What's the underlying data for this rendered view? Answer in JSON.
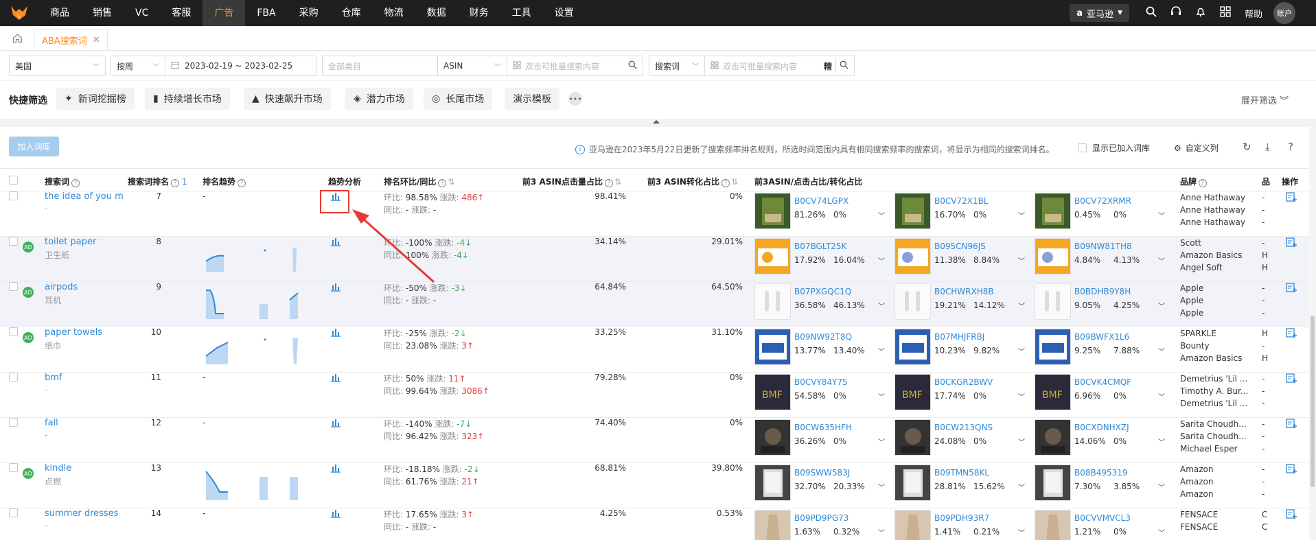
{
  "nav": {
    "items": [
      "商品",
      "销售",
      "VC",
      "客服",
      "广告",
      "FBA",
      "采购",
      "仓库",
      "物流",
      "数据",
      "财务",
      "工具",
      "设置"
    ],
    "active_index": 4,
    "market": "亚马逊",
    "help": "帮助",
    "account": "账户"
  },
  "tabs": {
    "page_tab": "ABA搜索词"
  },
  "filters": {
    "country": "美国",
    "period": "按周",
    "date_range": "2023-02-19 ~ 2023-02-25",
    "category_placeholder": "全部类目",
    "asin_type": "ASIN",
    "asin_placeholder": "双击可批量搜索内容",
    "term_type": "搜索词",
    "term_placeholder": "双击可批量搜索内容",
    "precise": "精"
  },
  "quick": {
    "label": "快捷筛选",
    "buttons": [
      "新词挖掘榜",
      "持续增长市场",
      "快速飙升市场",
      "潜力市场",
      "长尾市场",
      "演示模板"
    ],
    "expand": "展开筛选"
  },
  "toolbar": {
    "add_button": "加入词库",
    "notice": "亚马逊在2023年5月22日更新了搜索频率排名规则，所选时间范围内具有相同搜索频率的搜索词，将显示为相同的搜索词排名。",
    "show_added": "显示已加入词库",
    "custom_cols": "自定义列"
  },
  "columns": {
    "keyword": "搜索词",
    "rank": "搜索词排名",
    "rank_sort": "1",
    "rank_trend": "排名趋势",
    "trend": "趋势分析",
    "change": "排名环比/同比",
    "click_share": "前3 ASIN点击量占比",
    "conv_share": "前3 ASIN转化占比",
    "top3": "前3ASIN/点击占比/转化占比",
    "brand": "品牌",
    "brand2": "品",
    "ops": "操作"
  },
  "labels": {
    "hb": "环比:",
    "tb": "同比:",
    "zd": "涨跌:"
  },
  "rows": [
    {
      "keyword": "the idea of you m",
      "cn": "-",
      "ad": false,
      "rank": "7",
      "trend_text": "-",
      "hb": "98.58%",
      "hb_zd": "486",
      "hb_dir": "up",
      "tb": "-",
      "tb_zd": "-",
      "tb_dir": "",
      "click": "98.41%",
      "conv": "0%",
      "asins": [
        {
          "code": "B0CV74LGPX",
          "c": "81.26%",
          "v": "0%"
        },
        {
          "code": "B0CV72X1BL",
          "c": "16.70%",
          "v": "0%"
        },
        {
          "code": "B0CV72XRMR",
          "c": "0.45%",
          "v": "0%"
        }
      ],
      "brands": [
        "Anne Hathaway",
        "Anne Hathaway",
        "Anne Hathaway"
      ],
      "b2": [
        "-",
        "-",
        "-"
      ],
      "thumb": "book"
    },
    {
      "keyword": "toilet paper",
      "cn": "卫生纸",
      "ad": true,
      "rank": "8",
      "trend_text": "",
      "hb": "-100%",
      "hb_zd": "-4",
      "hb_dir": "down",
      "tb": "100%",
      "tb_zd": "-4",
      "tb_dir": "down",
      "click": "34.14%",
      "conv": "29.01%",
      "asins": [
        {
          "code": "B07BGLT25K",
          "c": "17.92%",
          "v": "16.04%"
        },
        {
          "code": "B095CN96JS",
          "c": "11.38%",
          "v": "8.84%"
        },
        {
          "code": "B09NW81TH8",
          "c": "4.84%",
          "v": "4.13%"
        }
      ],
      "brands": [
        "Scott",
        "Amazon Basics",
        "Angel Soft"
      ],
      "b2": [
        "-",
        "H",
        "H"
      ],
      "thumb": "paper"
    },
    {
      "keyword": "airpods",
      "cn": "耳机",
      "ad": true,
      "rank": "9",
      "trend_text": "",
      "hb": "-50%",
      "hb_zd": "-3",
      "hb_dir": "down",
      "tb": "-",
      "tb_zd": "-",
      "tb_dir": "",
      "click": "64.84%",
      "conv": "64.50%",
      "asins": [
        {
          "code": "B07PXGQC1Q",
          "c": "36.58%",
          "v": "46.13%"
        },
        {
          "code": "B0CHWRXH8B",
          "c": "19.21%",
          "v": "14.12%"
        },
        {
          "code": "B0BDHB9Y8H",
          "c": "9.05%",
          "v": "4.25%"
        }
      ],
      "brands": [
        "Apple",
        "Apple",
        "Apple"
      ],
      "b2": [
        "-",
        "-",
        "-"
      ],
      "thumb": "pods"
    },
    {
      "keyword": "paper towels",
      "cn": "纸巾",
      "ad": true,
      "rank": "10",
      "trend_text": "",
      "hb": "-25%",
      "hb_zd": "-2",
      "hb_dir": "down",
      "tb": "23.08%",
      "tb_zd": "3",
      "tb_dir": "up",
      "click": "33.25%",
      "conv": "31.10%",
      "asins": [
        {
          "code": "B09NW92T8Q",
          "c": "13.77%",
          "v": "13.40%"
        },
        {
          "code": "B07MHJFRBJ",
          "c": "10.23%",
          "v": "9.82%"
        },
        {
          "code": "B09BWFX1L6",
          "c": "9.25%",
          "v": "7.88%"
        }
      ],
      "brands": [
        "SPARKLE",
        "Bounty",
        "Amazon Basics"
      ],
      "b2": [
        "H",
        "-",
        "H"
      ],
      "thumb": "towel"
    },
    {
      "keyword": "bmf",
      "cn": "-",
      "ad": false,
      "rank": "11",
      "trend_text": "-",
      "hb": "50%",
      "hb_zd": "11",
      "hb_dir": "up",
      "tb": "99.64%",
      "tb_zd": "3086",
      "tb_dir": "up",
      "click": "79.28%",
      "conv": "0%",
      "asins": [
        {
          "code": "B0CVY84Y75",
          "c": "54.58%",
          "v": "0%"
        },
        {
          "code": "B0CKGR2BWV",
          "c": "17.74%",
          "v": "0%"
        },
        {
          "code": "B0CVK4CMQF",
          "c": "6.96%",
          "v": "0%"
        }
      ],
      "brands": [
        "Demetrius 'Lil ...",
        "Timothy A. Bur...",
        "Demetrius 'Lil ..."
      ],
      "b2": [
        "-",
        "-",
        "-"
      ],
      "thumb": "tv"
    },
    {
      "keyword": "fall",
      "cn": "-",
      "ad": false,
      "rank": "12",
      "trend_text": "-",
      "hb": "-140%",
      "hb_zd": "-7",
      "hb_dir": "down",
      "tb": "96.42%",
      "tb_zd": "323",
      "tb_dir": "up",
      "click": "74.40%",
      "conv": "0%",
      "asins": [
        {
          "code": "B0CW635HFH",
          "c": "36.26%",
          "v": "0%"
        },
        {
          "code": "B0CW213QNS",
          "c": "24.08%",
          "v": "0%"
        },
        {
          "code": "B0CXDNHXZJ",
          "c": "14.06%",
          "v": "0%"
        }
      ],
      "brands": [
        "Sarita Choudh...",
        "Sarita Choudh...",
        "Michael Esper"
      ],
      "b2": [
        "-",
        "-",
        "-"
      ],
      "thumb": "movie"
    },
    {
      "keyword": "kindle",
      "cn": "点燃",
      "ad": true,
      "rank": "13",
      "trend_text": "",
      "hb": "-18.18%",
      "hb_zd": "-2",
      "hb_dir": "down",
      "tb": "61.76%",
      "tb_zd": "21",
      "tb_dir": "up",
      "click": "68.81%",
      "conv": "39.80%",
      "asins": [
        {
          "code": "B09SWW583J",
          "c": "32.70%",
          "v": "20.33%"
        },
        {
          "code": "B09TMN58KL",
          "c": "28.81%",
          "v": "15.62%"
        },
        {
          "code": "B08B495319",
          "c": "7.30%",
          "v": "3.85%"
        }
      ],
      "brands": [
        "Amazon",
        "Amazon",
        "Amazon"
      ],
      "b2": [
        "-",
        "-",
        "-"
      ],
      "thumb": "kindle"
    },
    {
      "keyword": "summer dresses",
      "cn": "-",
      "ad": false,
      "rank": "14",
      "trend_text": "-",
      "hb": "17.65%",
      "hb_zd": "3",
      "hb_dir": "up",
      "tb": "-",
      "tb_zd": "-",
      "tb_dir": "",
      "click": "4.25%",
      "conv": "0.53%",
      "asins": [
        {
          "code": "B09PD9PG73",
          "c": "1.63%",
          "v": "0.32%"
        },
        {
          "code": "B09PDH93R7",
          "c": "1.41%",
          "v": "0.21%"
        },
        {
          "code": "B0CVVMVCL3",
          "c": "1.21%",
          "v": "0%"
        }
      ],
      "brands": [
        "FENSACE",
        "FENSACE",
        ""
      ],
      "b2": [
        "C",
        "C",
        ""
      ],
      "thumb": "dress"
    }
  ],
  "colors": {
    "accent": "#2f89d9",
    "brand_orange": "#ff8a1f",
    "up": "#e43a3a",
    "down": "#3fa64f",
    "ad_green": "#3fb15b",
    "annotation": "#e53935"
  }
}
